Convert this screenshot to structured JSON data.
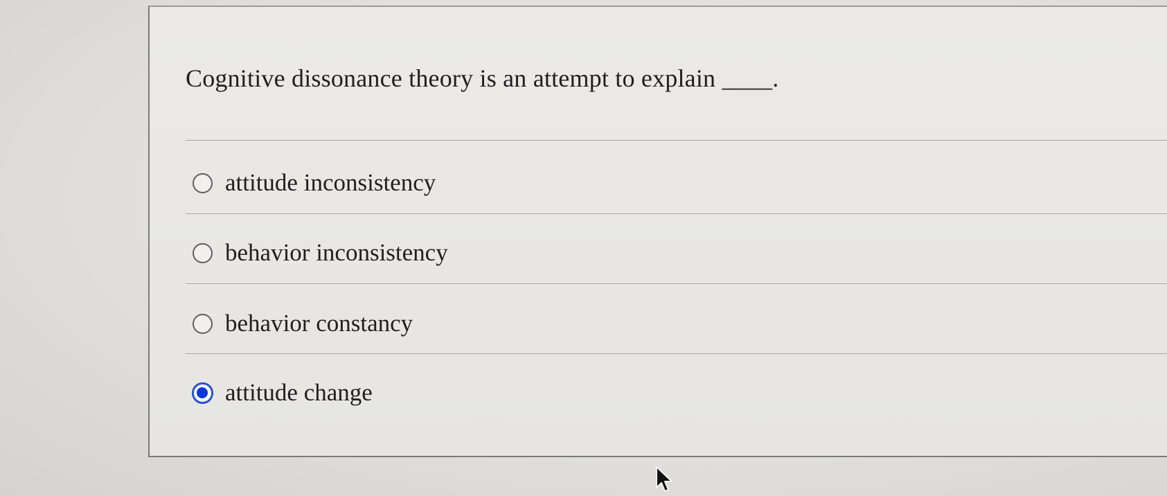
{
  "question": {
    "prompt": "Cognitive dissonance theory is an attempt to explain ____."
  },
  "options": [
    {
      "label": "attitude inconsistency",
      "selected": false
    },
    {
      "label": "behavior inconsistency",
      "selected": false
    },
    {
      "label": "behavior constancy",
      "selected": false
    },
    {
      "label": "attitude change",
      "selected": true
    }
  ],
  "colors": {
    "selected_radio": "#0b38d9",
    "background": "#e6e5e2"
  }
}
